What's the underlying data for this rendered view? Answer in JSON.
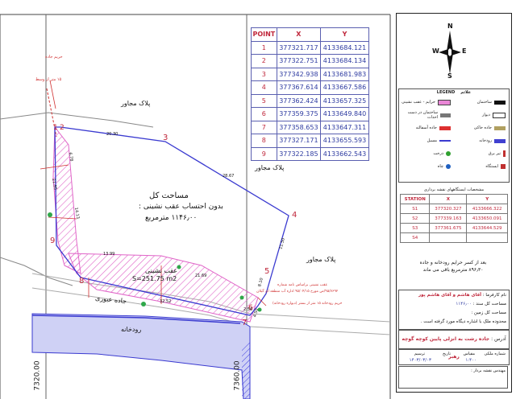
{
  "points_table": {
    "headers": [
      "POINT",
      "X",
      "Y"
    ],
    "rows": [
      [
        "1",
        "377321.717",
        "4133684.121"
      ],
      [
        "2",
        "377322.751",
        "4133684.134"
      ],
      [
        "3",
        "377342.938",
        "4133681.983"
      ],
      [
        "4",
        "377367.614",
        "4133667.586"
      ],
      [
        "5",
        "377362.424",
        "4133657.325"
      ],
      [
        "6",
        "377359.375",
        "4133649.840"
      ],
      [
        "7",
        "377358.653",
        "4133647.311"
      ],
      [
        "8",
        "377327.171",
        "4133655.593"
      ],
      [
        "9",
        "377322.185",
        "4133662.543"
      ]
    ]
  },
  "compass": {
    "n": "N",
    "s": "S",
    "e": "E",
    "w": "W"
  },
  "legend": {
    "title": "LEGEND",
    "title_fa": "علائم",
    "items": [
      {
        "label": "حرایم - عقب نشینی",
        "color": "#e986d6"
      },
      {
        "label": "ساختمان",
        "color": "#111111"
      },
      {
        "label": "ساختمان در دست احداث",
        "color": "#777777"
      },
      {
        "label": "دیوار",
        "color": "#333333"
      },
      {
        "label": "جاده آسفالته",
        "color": "#dd3030"
      },
      {
        "label": "جاده خاکی",
        "color": "#b0a060"
      },
      {
        "label": "مسیل",
        "color": "#3a3ad0"
      },
      {
        "label": "رودخانه",
        "color": "#4040d0"
      },
      {
        "label": "درخت",
        "color": "#30a030"
      },
      {
        "label": "تیر برق",
        "color": "#c03030"
      },
      {
        "label": "چاه",
        "color": "#2060c0"
      },
      {
        "label": "ایستگاه",
        "color": "#c03030"
      }
    ]
  },
  "control_table": {
    "title": "مشخصات ایستگاههای نقشه برداری",
    "headers": [
      "STATION",
      "X",
      "Y"
    ],
    "rows": [
      [
        "S1",
        "377320.327",
        "4133666.322"
      ],
      [
        "S2",
        "377339.163",
        "4133650.091"
      ],
      [
        "S3",
        "377361.675",
        "4133644.529"
      ],
      [
        "S4",
        "",
        ""
      ]
    ]
  },
  "map": {
    "points": [
      "1",
      "2",
      "3",
      "4",
      "5",
      "6",
      "7",
      "8",
      "9"
    ],
    "grid_labels": [
      "7320.00",
      "7360.00"
    ],
    "total_area": "مساحت کل",
    "area_note": "بدون احتساب عقب نشینی :",
    "area_value": "۱۱۴۶٫۰۰ مترمربع",
    "setback_title": "عقب نشینی",
    "setback_area": "S=251.75 m2",
    "neighbor_top": "پلاک مجاور",
    "neighbor_mid": "پلاک مجاور",
    "neighbor_right": "پلاک مجاور",
    "road": "جاده عبوری",
    "river": "رودخانه",
    "buffer_note_1": "حریم جاده",
    "buffer_note_2": "۱۵ متر از وسط",
    "setback_note_1": "عقب نشینی براساس نامه شماره",
    "setback_note_2": "۹۵/۷۶۹۲/ص مورخ ۹۵/۰۴/۱۵ اداره آب منطقه ای گیلان",
    "setback_note_3": "حریم رودخانه ۱۵ متر از بستر (دیواره رودخانه)",
    "dist_1": "20.30",
    "dist_2": "28.67",
    "dist_3": "11.50",
    "dist_4": "8.10",
    "dist_5": "13.99",
    "dist_6": "21.69",
    "dist_7": "32.52",
    "dist_8": "21.95",
    "dist_9": "6.78",
    "dist_10": "14.13",
    "dist_11": "4.50",
    "dist_12": "2.56"
  },
  "notes": {
    "summary_1": "بعد از کسر حرایم رودخانه و جاده",
    "summary_2": "۸۹۶٫۳۰ مترمربع باقی می ماند"
  },
  "info": {
    "owner_label": "نام کارفرما :",
    "owner": "آقای هاشم و آقای هاشم پور",
    "area_doc_label": "مساحت کل سند :",
    "area_doc_value": "۱۱۴۶٫۰۰",
    "area_measured_label": "مساحت کل زمین :",
    "boundary_label": "محدوده ملک با اشاره دیگاه مورد گرفته است ."
  },
  "address": {
    "label": "آدرس :",
    "value": "جاده رشت به انزلی پایین کوچه گوچه رهبر"
  },
  "sign": {
    "col1": "شماره ملکی",
    "col2": "مقیاس",
    "col3": "تاریخ",
    "col4": "ترسیم",
    "date": "۱۴۰۳/۰۳/۰۳",
    "scale": "۱:۴۰۰"
  },
  "bottom": {
    "label": "مهندس نقشه بردار :"
  }
}
